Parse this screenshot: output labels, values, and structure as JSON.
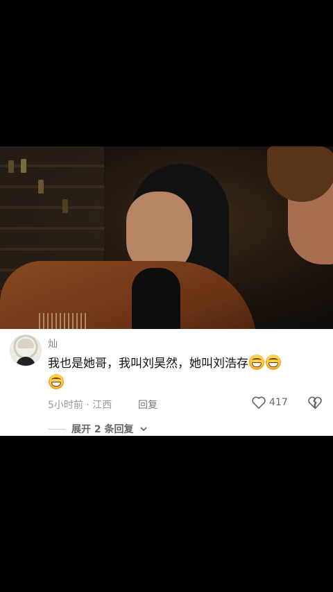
{
  "comment": {
    "username": "灿",
    "text": "我也是她哥，我叫刘昊然，她叫刘浩存",
    "emoji_count": 3,
    "time_location": "5小时前 · 江西",
    "reply_label": "回复",
    "like_count": "417",
    "expand_replies": "展开 2 条回复"
  },
  "icons": [
    "heart-outline-icon",
    "broken-heart-icon",
    "chevron-down-icon",
    "grin-emoji-icon"
  ],
  "colors": {
    "background": "#000000",
    "panel": "#ffffff",
    "meta_text": "#999999"
  }
}
